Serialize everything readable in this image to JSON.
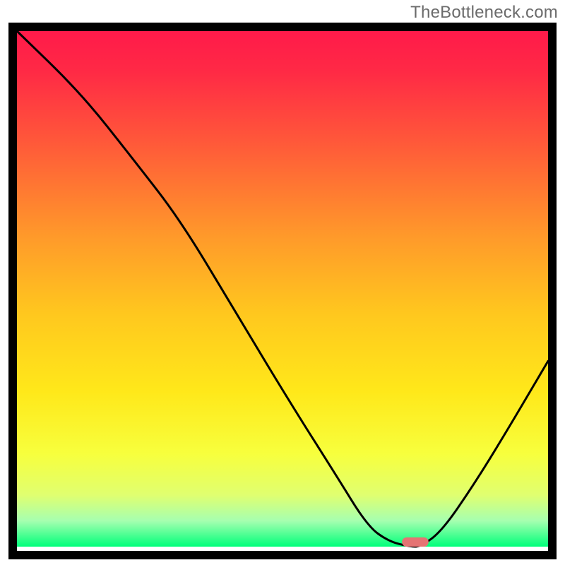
{
  "watermark": "TheBottleneck.com",
  "chart_data": {
    "type": "line",
    "title": "",
    "xlabel": "",
    "ylabel": "",
    "xlim": [
      0,
      100
    ],
    "ylim": [
      0,
      100
    ],
    "grid": false,
    "background": {
      "gradient_stops": [
        {
          "offset": 0.0,
          "color": "#ff1a4a"
        },
        {
          "offset": 0.08,
          "color": "#ff2a45"
        },
        {
          "offset": 0.22,
          "color": "#ff5a39"
        },
        {
          "offset": 0.4,
          "color": "#ff9a2a"
        },
        {
          "offset": 0.55,
          "color": "#ffc81e"
        },
        {
          "offset": 0.7,
          "color": "#ffe81a"
        },
        {
          "offset": 0.82,
          "color": "#f7ff3d"
        },
        {
          "offset": 0.9,
          "color": "#e0ff70"
        },
        {
          "offset": 0.95,
          "color": "#a6ffb0"
        },
        {
          "offset": 1.0,
          "color": "#00ff7a"
        }
      ]
    },
    "series": [
      {
        "name": "curve",
        "x": [
          0,
          12,
          22,
          31,
          42,
          52,
          60,
          66,
          70,
          74,
          76,
          80,
          86,
          92,
          100
        ],
        "y": [
          100,
          88,
          75,
          63,
          44,
          27,
          14,
          4,
          1,
          0,
          0,
          3,
          12,
          22,
          36
        ]
      }
    ],
    "marker": {
      "x_center": 75,
      "y": 0,
      "width": 5,
      "height": 1.8,
      "color": "#e57373"
    }
  }
}
